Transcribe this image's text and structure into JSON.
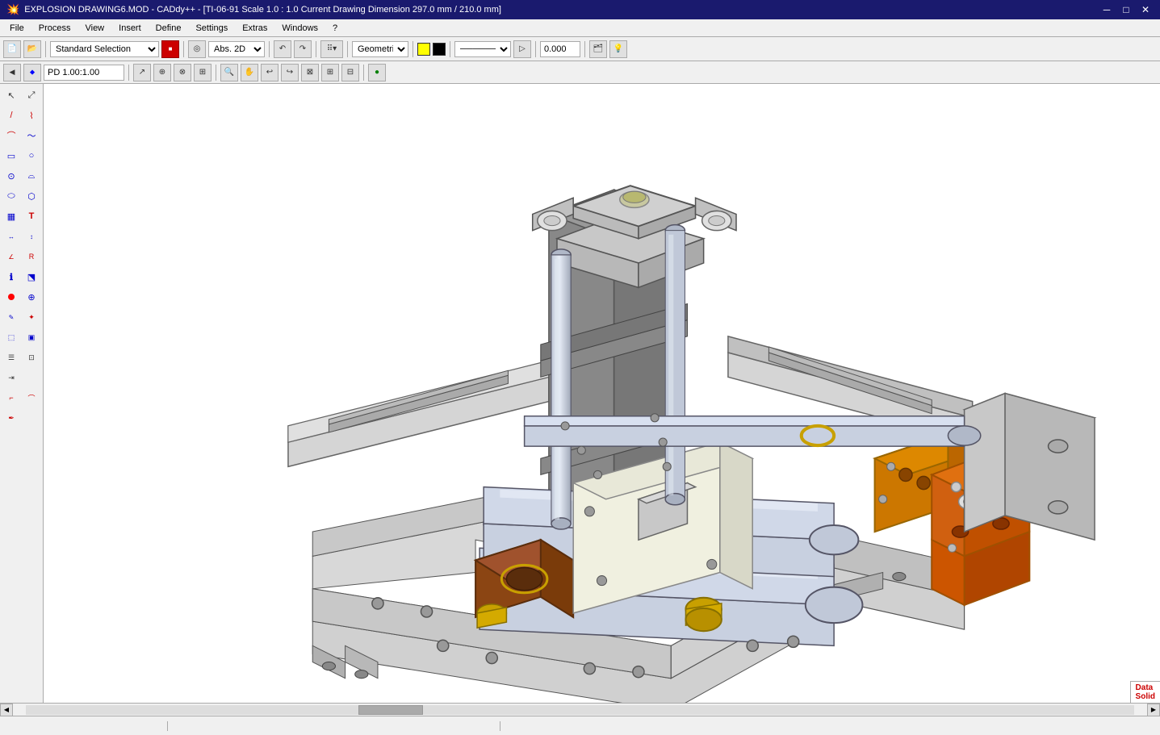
{
  "titlebar": {
    "icon": "💥",
    "title": "EXPLOSION DRAWING6.MOD - CADdy++ - [TI-06-91  Scale 1.0 : 1.0  Current Drawing Dimension 297.0 mm / 210.0 mm]",
    "min_btn": "─",
    "max_btn": "□",
    "close_btn": "✕",
    "sub_min": "─",
    "sub_max": "□",
    "sub_close": "✕"
  },
  "menubar": {
    "items": [
      "File",
      "Process",
      "View",
      "Insert",
      "Define",
      "Settings",
      "Extras",
      "Windows",
      "?"
    ]
  },
  "toolbar1": {
    "standard_selection_label": "Standard Selection",
    "coord_mode": "Abs. 2D",
    "layer_name": "Geometrie",
    "line_width": "0.000",
    "icons": [
      "new",
      "open",
      "save",
      "print",
      "select-dropdown",
      "rect-select",
      "coord-dropdown",
      "undo",
      "redo",
      "grid",
      "layer-dropdown",
      "color-yellow",
      "color-black",
      "line-style-dropdown",
      "line-width-input",
      "layer-icons",
      "bulb-icon"
    ]
  },
  "toolbar2": {
    "pd_value": "PD 1.00:1.00",
    "icons": [
      "snap-point",
      "snap-grid",
      "snap-mid",
      "snap-perp",
      "zoom-window",
      "pan",
      "undo2",
      "redo2",
      "zoom-fit",
      "zoom-in",
      "zoom-out",
      "redraw"
    ]
  },
  "left_toolbar": {
    "tool_groups": [
      [
        "arrow",
        "arrow-cross"
      ],
      [
        "line",
        "free-line"
      ],
      [
        "polyline",
        "spline"
      ],
      [
        "rect",
        "circle-r"
      ],
      [
        "circle-d",
        "arc"
      ],
      [
        "ellipse",
        "polygon"
      ],
      [
        "hatch",
        "text"
      ],
      [
        "dim-horiz",
        "dim-vert"
      ],
      [
        "dim-angle",
        "dim-radius"
      ],
      [
        "dim-auto",
        "center-line"
      ],
      [
        "symbol",
        "block"
      ],
      [
        "move",
        "copy"
      ],
      [
        "rotate",
        "mirror"
      ],
      [
        "scale",
        "trim"
      ],
      [
        "extend",
        "break"
      ],
      [
        "chamfer",
        "fillet"
      ],
      [
        "offset",
        "array"
      ],
      [
        "erase",
        "properties"
      ],
      [
        "info",
        "measure"
      ],
      [
        "layer",
        "pen"
      ]
    ]
  },
  "statusbar": {
    "segments": [
      "",
      "",
      ""
    ],
    "datasolid": "Data\nSolid"
  },
  "canvas": {
    "drawing_description": "3D isometric CAD assembly drawing showing mechanical device with aluminum plates, cylinders, bearings and orange/bronze clamp components"
  }
}
